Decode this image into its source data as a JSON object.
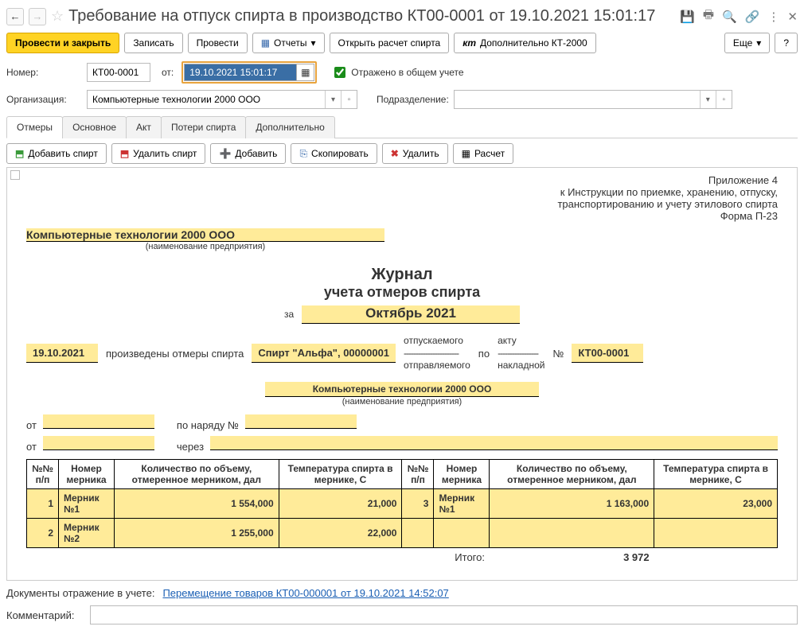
{
  "titlebar": {
    "title": "Требование на отпуск спирта в производство КТ00-0001 от 19.10.2021 15:01:17"
  },
  "cmdbar": {
    "post_close": "Провести и закрыть",
    "save": "Записать",
    "post": "Провести",
    "reports": "Отчеты",
    "open_calc": "Открыть расчет спирта",
    "extra": "Дополнительно КТ-2000",
    "more": "Еще",
    "help": "?"
  },
  "form": {
    "number_label": "Номер:",
    "number_value": "КТ00-0001",
    "from_label": "от:",
    "date_value": "19.10.2021 15:01:17",
    "reflected_label": "Отражено в общем учете",
    "org_label": "Организация:",
    "org_value": "Компьютерные технологии 2000 ООО",
    "dept_label": "Подразделение:",
    "dept_value": ""
  },
  "tabs": [
    "Отмеры",
    "Основное",
    "Акт",
    "Потери спирта",
    "Дополнительно"
  ],
  "toolbar2": {
    "add_spirit": "Добавить спирт",
    "del_spirit": "Удалить спирт",
    "add": "Добавить",
    "copy": "Скопировать",
    "delete": "Удалить",
    "calc": "Расчет"
  },
  "doc": {
    "appendix": "Приложение 4",
    "instr1": "к Инструкции по приемке, хранению, отпуску,",
    "instr2": "транспортированию и учету этилового спирта",
    "form_no": "Форма П-23",
    "org": "Компьютерные технологии 2000 ООО",
    "org_sub": "(наименование предприятия)",
    "title1": "Журнал",
    "title2": "учета отмеров спирта",
    "period_label": "за",
    "period": "Октябрь 2021",
    "date": "19.10.2021",
    "produced": "произведены отмеры спирта",
    "spirit": "Спирт \"Альфа\", 00000001",
    "sent_top": "отпускаемого",
    "sent_bot": "отправляемого",
    "by": "по",
    "act_top": "акту",
    "act_bot": "накладной",
    "no_label": "№",
    "doc_no": "КТ00-0001",
    "from_label": "от",
    "order_label": "по наряду №",
    "via_label": "через"
  },
  "table": {
    "headers": [
      "№№ п/п",
      "Номер мерника",
      "Количество по объему, отмеренное мерником, дал",
      "Температура спирта в мернике, С",
      "№№ п/п",
      "Номер мерника",
      "Количество по объему, отмеренное мерником, дал",
      "Температура спирта в мернике, С"
    ],
    "rows": [
      {
        "n1": "1",
        "m1": "Мерник №1",
        "q1": "1 554,000",
        "t1": "21,000",
        "n2": "3",
        "m2": "Мерник №1",
        "q2": "1 163,000",
        "t2": "23,000"
      },
      {
        "n1": "2",
        "m1": "Мерник №2",
        "q1": "1 255,000",
        "t1": "22,000",
        "n2": "",
        "m2": "",
        "q2": "",
        "t2": ""
      }
    ],
    "total_label": "Итого:",
    "total": "3 972"
  },
  "footer": {
    "docs_label": "Документы отражение в учете:",
    "link": "Перемещение товаров КТ00-000001 от 19.10.2021 14:52:07",
    "comment_label": "Комментарий:",
    "comment_value": ""
  }
}
